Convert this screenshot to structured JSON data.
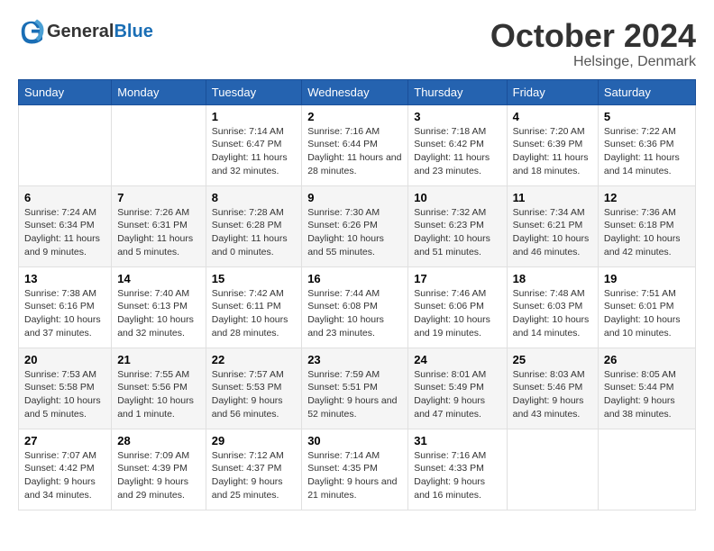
{
  "header": {
    "logo_line1": "General",
    "logo_line2": "Blue",
    "month_title": "October 2024",
    "location": "Helsinge, Denmark"
  },
  "weekdays": [
    "Sunday",
    "Monday",
    "Tuesday",
    "Wednesday",
    "Thursday",
    "Friday",
    "Saturday"
  ],
  "weeks": [
    [
      {
        "day": "",
        "sunrise": "",
        "sunset": "",
        "daylight": ""
      },
      {
        "day": "",
        "sunrise": "",
        "sunset": "",
        "daylight": ""
      },
      {
        "day": "1",
        "sunrise": "Sunrise: 7:14 AM",
        "sunset": "Sunset: 6:47 PM",
        "daylight": "Daylight: 11 hours and 32 minutes."
      },
      {
        "day": "2",
        "sunrise": "Sunrise: 7:16 AM",
        "sunset": "Sunset: 6:44 PM",
        "daylight": "Daylight: 11 hours and 28 minutes."
      },
      {
        "day": "3",
        "sunrise": "Sunrise: 7:18 AM",
        "sunset": "Sunset: 6:42 PM",
        "daylight": "Daylight: 11 hours and 23 minutes."
      },
      {
        "day": "4",
        "sunrise": "Sunrise: 7:20 AM",
        "sunset": "Sunset: 6:39 PM",
        "daylight": "Daylight: 11 hours and 18 minutes."
      },
      {
        "day": "5",
        "sunrise": "Sunrise: 7:22 AM",
        "sunset": "Sunset: 6:36 PM",
        "daylight": "Daylight: 11 hours and 14 minutes."
      }
    ],
    [
      {
        "day": "6",
        "sunrise": "Sunrise: 7:24 AM",
        "sunset": "Sunset: 6:34 PM",
        "daylight": "Daylight: 11 hours and 9 minutes."
      },
      {
        "day": "7",
        "sunrise": "Sunrise: 7:26 AM",
        "sunset": "Sunset: 6:31 PM",
        "daylight": "Daylight: 11 hours and 5 minutes."
      },
      {
        "day": "8",
        "sunrise": "Sunrise: 7:28 AM",
        "sunset": "Sunset: 6:28 PM",
        "daylight": "Daylight: 11 hours and 0 minutes."
      },
      {
        "day": "9",
        "sunrise": "Sunrise: 7:30 AM",
        "sunset": "Sunset: 6:26 PM",
        "daylight": "Daylight: 10 hours and 55 minutes."
      },
      {
        "day": "10",
        "sunrise": "Sunrise: 7:32 AM",
        "sunset": "Sunset: 6:23 PM",
        "daylight": "Daylight: 10 hours and 51 minutes."
      },
      {
        "day": "11",
        "sunrise": "Sunrise: 7:34 AM",
        "sunset": "Sunset: 6:21 PM",
        "daylight": "Daylight: 10 hours and 46 minutes."
      },
      {
        "day": "12",
        "sunrise": "Sunrise: 7:36 AM",
        "sunset": "Sunset: 6:18 PM",
        "daylight": "Daylight: 10 hours and 42 minutes."
      }
    ],
    [
      {
        "day": "13",
        "sunrise": "Sunrise: 7:38 AM",
        "sunset": "Sunset: 6:16 PM",
        "daylight": "Daylight: 10 hours and 37 minutes."
      },
      {
        "day": "14",
        "sunrise": "Sunrise: 7:40 AM",
        "sunset": "Sunset: 6:13 PM",
        "daylight": "Daylight: 10 hours and 32 minutes."
      },
      {
        "day": "15",
        "sunrise": "Sunrise: 7:42 AM",
        "sunset": "Sunset: 6:11 PM",
        "daylight": "Daylight: 10 hours and 28 minutes."
      },
      {
        "day": "16",
        "sunrise": "Sunrise: 7:44 AM",
        "sunset": "Sunset: 6:08 PM",
        "daylight": "Daylight: 10 hours and 23 minutes."
      },
      {
        "day": "17",
        "sunrise": "Sunrise: 7:46 AM",
        "sunset": "Sunset: 6:06 PM",
        "daylight": "Daylight: 10 hours and 19 minutes."
      },
      {
        "day": "18",
        "sunrise": "Sunrise: 7:48 AM",
        "sunset": "Sunset: 6:03 PM",
        "daylight": "Daylight: 10 hours and 14 minutes."
      },
      {
        "day": "19",
        "sunrise": "Sunrise: 7:51 AM",
        "sunset": "Sunset: 6:01 PM",
        "daylight": "Daylight: 10 hours and 10 minutes."
      }
    ],
    [
      {
        "day": "20",
        "sunrise": "Sunrise: 7:53 AM",
        "sunset": "Sunset: 5:58 PM",
        "daylight": "Daylight: 10 hours and 5 minutes."
      },
      {
        "day": "21",
        "sunrise": "Sunrise: 7:55 AM",
        "sunset": "Sunset: 5:56 PM",
        "daylight": "Daylight: 10 hours and 1 minute."
      },
      {
        "day": "22",
        "sunrise": "Sunrise: 7:57 AM",
        "sunset": "Sunset: 5:53 PM",
        "daylight": "Daylight: 9 hours and 56 minutes."
      },
      {
        "day": "23",
        "sunrise": "Sunrise: 7:59 AM",
        "sunset": "Sunset: 5:51 PM",
        "daylight": "Daylight: 9 hours and 52 minutes."
      },
      {
        "day": "24",
        "sunrise": "Sunrise: 8:01 AM",
        "sunset": "Sunset: 5:49 PM",
        "daylight": "Daylight: 9 hours and 47 minutes."
      },
      {
        "day": "25",
        "sunrise": "Sunrise: 8:03 AM",
        "sunset": "Sunset: 5:46 PM",
        "daylight": "Daylight: 9 hours and 43 minutes."
      },
      {
        "day": "26",
        "sunrise": "Sunrise: 8:05 AM",
        "sunset": "Sunset: 5:44 PM",
        "daylight": "Daylight: 9 hours and 38 minutes."
      }
    ],
    [
      {
        "day": "27",
        "sunrise": "Sunrise: 7:07 AM",
        "sunset": "Sunset: 4:42 PM",
        "daylight": "Daylight: 9 hours and 34 minutes."
      },
      {
        "day": "28",
        "sunrise": "Sunrise: 7:09 AM",
        "sunset": "Sunset: 4:39 PM",
        "daylight": "Daylight: 9 hours and 29 minutes."
      },
      {
        "day": "29",
        "sunrise": "Sunrise: 7:12 AM",
        "sunset": "Sunset: 4:37 PM",
        "daylight": "Daylight: 9 hours and 25 minutes."
      },
      {
        "day": "30",
        "sunrise": "Sunrise: 7:14 AM",
        "sunset": "Sunset: 4:35 PM",
        "daylight": "Daylight: 9 hours and 21 minutes."
      },
      {
        "day": "31",
        "sunrise": "Sunrise: 7:16 AM",
        "sunset": "Sunset: 4:33 PM",
        "daylight": "Daylight: 9 hours and 16 minutes."
      },
      {
        "day": "",
        "sunrise": "",
        "sunset": "",
        "daylight": ""
      },
      {
        "day": "",
        "sunrise": "",
        "sunset": "",
        "daylight": ""
      }
    ]
  ]
}
